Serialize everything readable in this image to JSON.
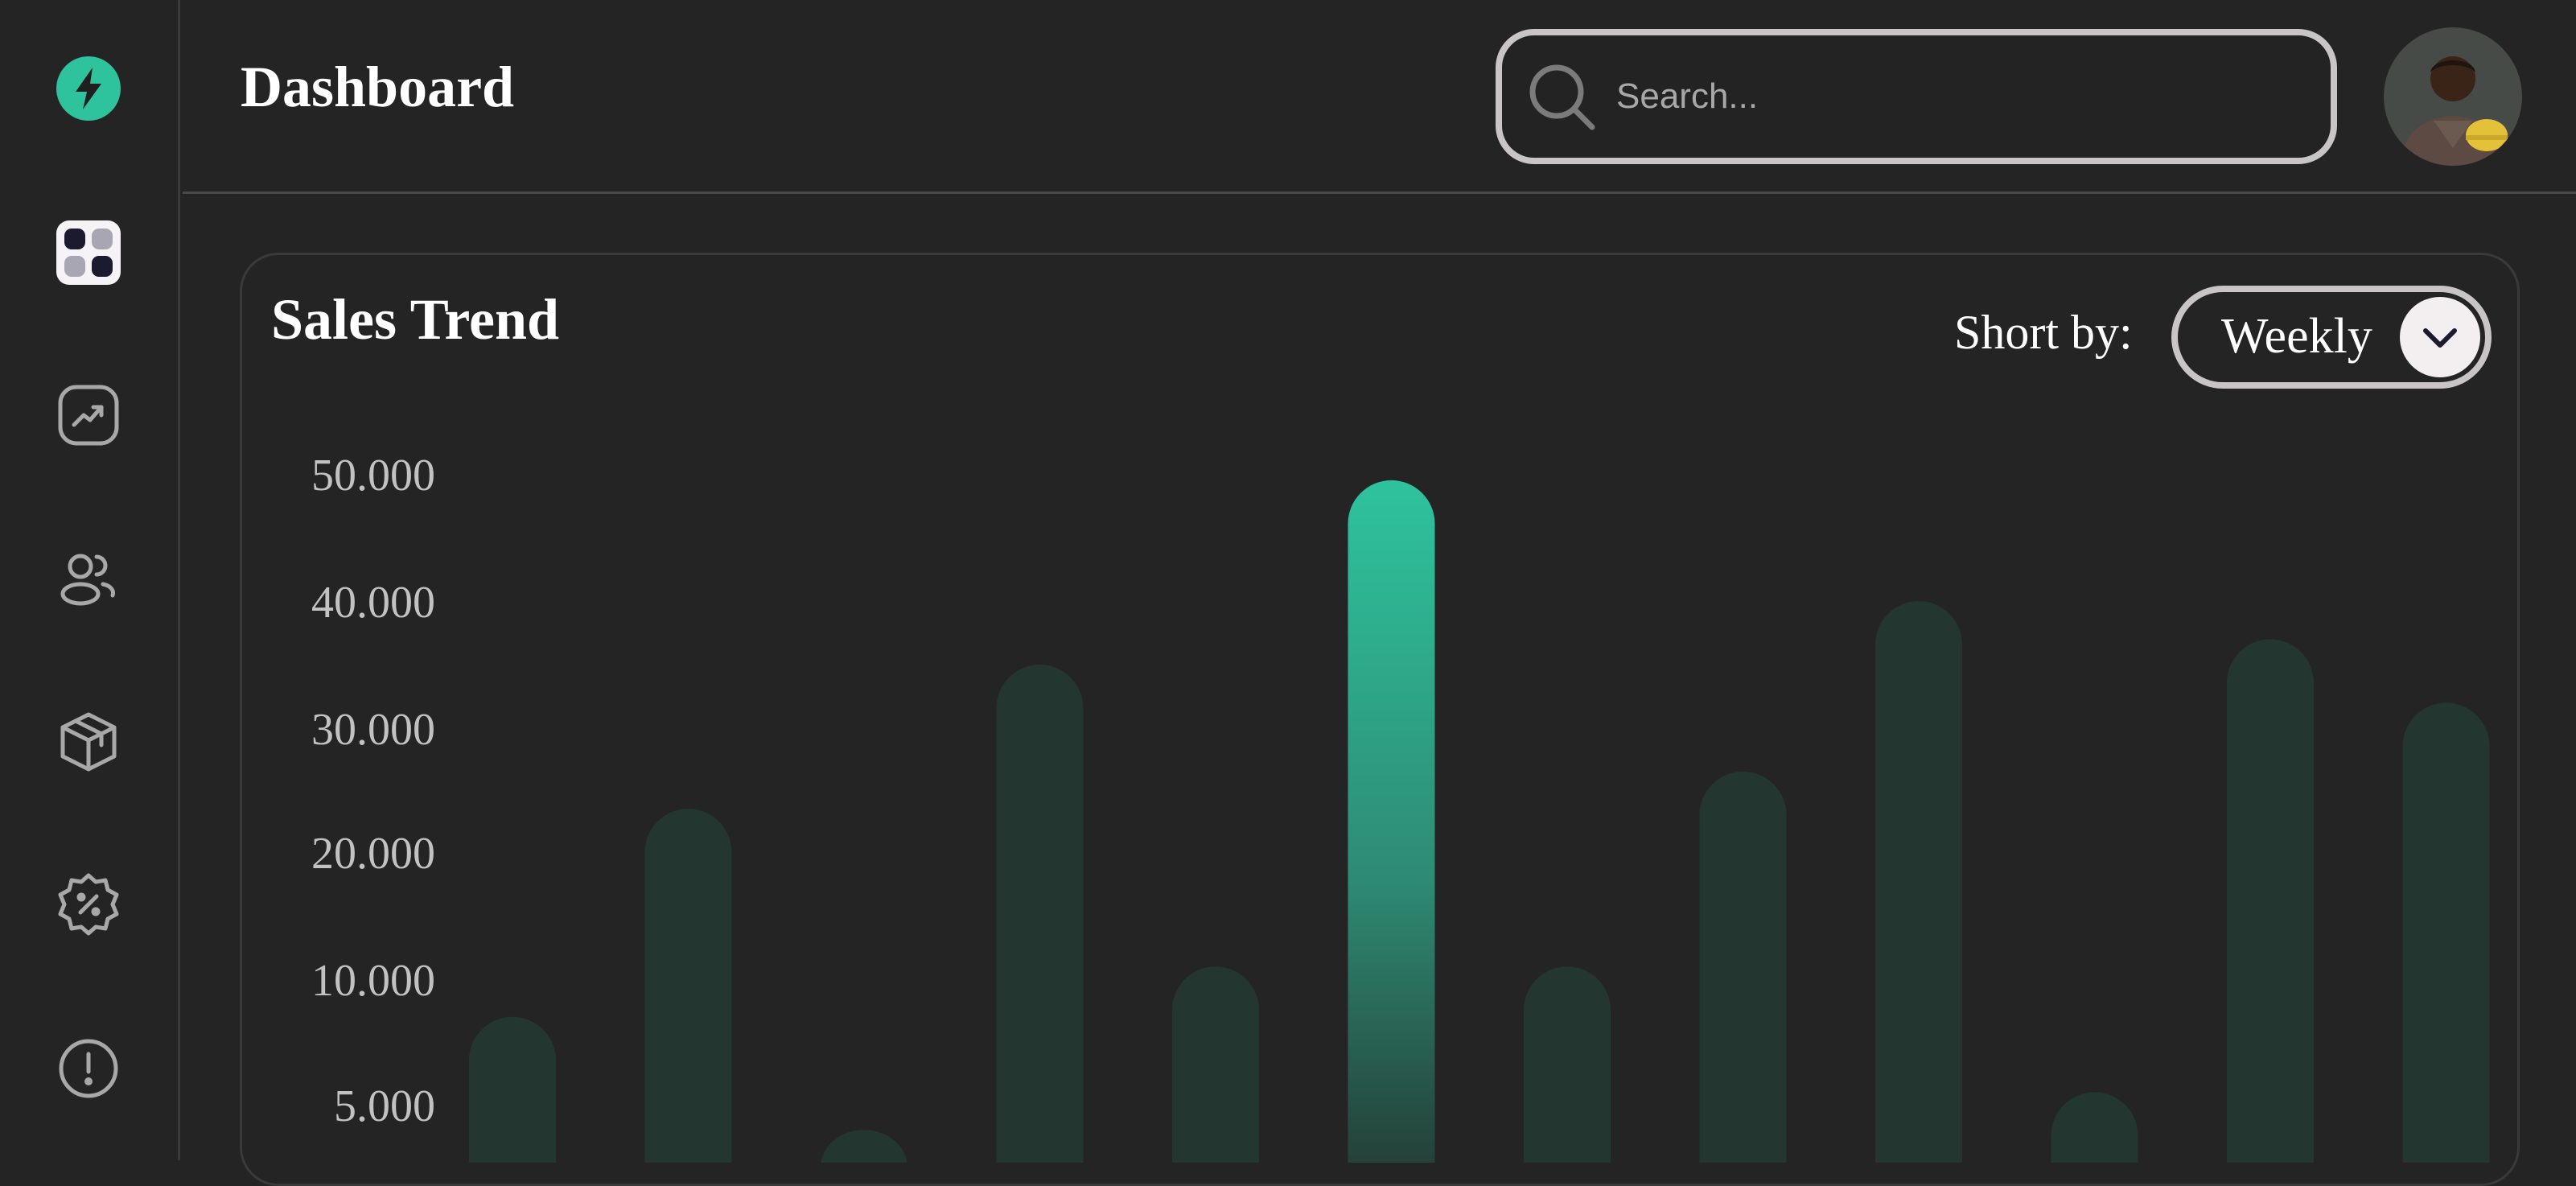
{
  "header": {
    "title": "Dashboard",
    "search_placeholder": "Search..."
  },
  "sidebar": {
    "items": [
      {
        "name": "logo",
        "icon": "lightning-bolt-icon"
      },
      {
        "name": "dashboard",
        "icon": "grid-icon",
        "active": true
      },
      {
        "name": "analytics",
        "icon": "trend-icon"
      },
      {
        "name": "customers",
        "icon": "users-icon"
      },
      {
        "name": "products",
        "icon": "box-icon"
      },
      {
        "name": "discounts",
        "icon": "discount-badge-icon"
      },
      {
        "name": "info",
        "icon": "alert-circle-icon"
      }
    ]
  },
  "card": {
    "title": "Sales Trend",
    "sort_label": "Short by:",
    "sort_value": "Weekly"
  },
  "colors": {
    "accent": "#2ec39d",
    "bar_muted": "#233630",
    "background": "#242424"
  },
  "chart_data": {
    "type": "bar",
    "title": "Sales Trend",
    "xlabel": "",
    "ylabel": "",
    "y_ticks": [
      "50.000",
      "40.000",
      "30.000",
      "20.000",
      "10.000",
      "5.000"
    ],
    "values": [
      8500,
      23500,
      4000,
      35000,
      11000,
      49500,
      11000,
      26500,
      40000,
      5500,
      37000,
      32000
    ],
    "highlight_index": 5,
    "grid": false
  }
}
